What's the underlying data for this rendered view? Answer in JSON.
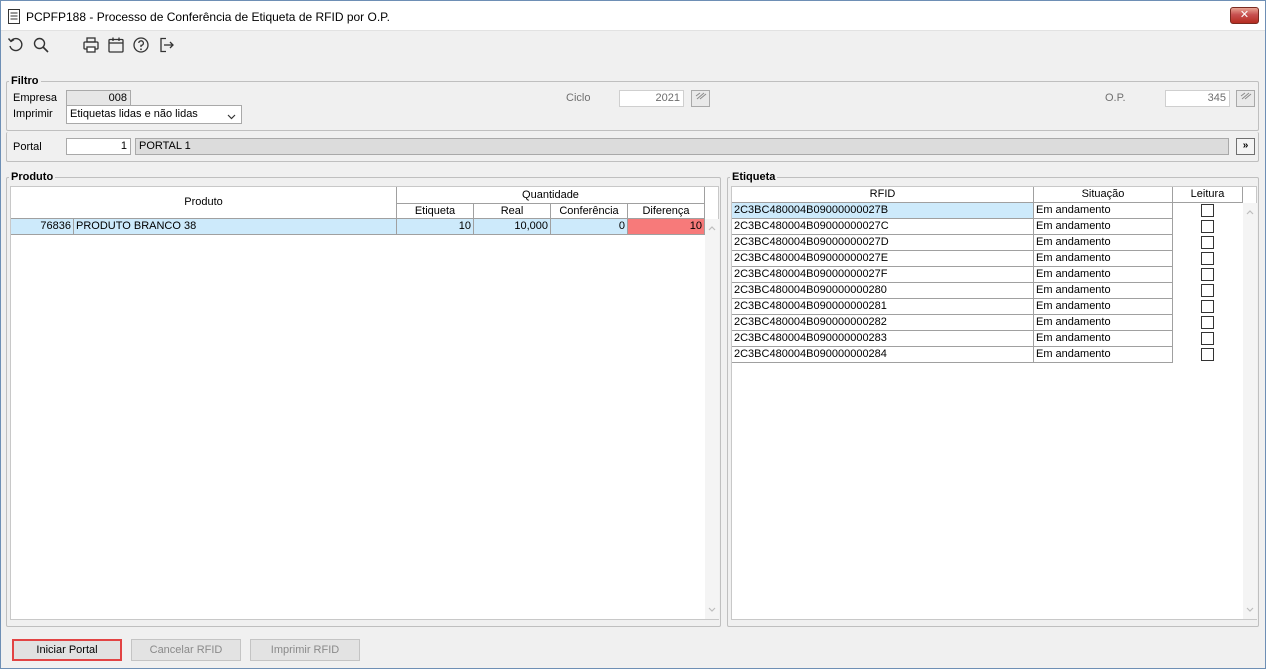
{
  "window": {
    "title": "PCPFP188 - Processo de Conferência de Etiqueta de RFID por O.P.",
    "close_label": "✕"
  },
  "toolbar": {
    "icons": [
      "refresh-icon",
      "search-icon",
      "print-icon",
      "calendar-icon",
      "help-icon",
      "exit-icon"
    ]
  },
  "filtro": {
    "legend": "Filtro",
    "empresa_label": "Empresa",
    "empresa_value": "008",
    "imprimir_label": "Imprimir",
    "imprimir_value": "Etiquetas lidas e não lidas",
    "ciclo_label": "Ciclo",
    "ciclo_value": "2021",
    "op_label": "O.P.",
    "op_value": "345",
    "portal_label": "Portal",
    "portal_value": "1",
    "portal_desc": "PORTAL 1",
    "portal_button": "»"
  },
  "produto": {
    "legend": "Produto",
    "header_produto": "Produto",
    "header_quantidade": "Quantidade",
    "header_etiqueta": "Etiqueta",
    "header_real": "Real",
    "header_conferencia": "Conferência",
    "header_diferenca": "Diferença",
    "rows": [
      {
        "codigo": "76836",
        "descricao": "PRODUTO BRANCO 38",
        "etiqueta": "10",
        "real": "10,000",
        "conferencia": "0",
        "diferenca": "10"
      }
    ]
  },
  "etiqueta": {
    "legend": "Etiqueta",
    "header_rfid": "RFID",
    "header_situacao": "Situação",
    "header_leitura": "Leitura",
    "rows": [
      {
        "rfid": "2C3BC480004B09000000027B",
        "situacao": "Em andamento"
      },
      {
        "rfid": "2C3BC480004B09000000027C",
        "situacao": "Em andamento"
      },
      {
        "rfid": "2C3BC480004B09000000027D",
        "situacao": "Em andamento"
      },
      {
        "rfid": "2C3BC480004B09000000027E",
        "situacao": "Em andamento"
      },
      {
        "rfid": "2C3BC480004B09000000027F",
        "situacao": "Em andamento"
      },
      {
        "rfid": "2C3BC480004B090000000280",
        "situacao": "Em andamento"
      },
      {
        "rfid": "2C3BC480004B090000000281",
        "situacao": "Em andamento"
      },
      {
        "rfid": "2C3BC480004B090000000282",
        "situacao": "Em andamento"
      },
      {
        "rfid": "2C3BC480004B090000000283",
        "situacao": "Em andamento"
      },
      {
        "rfid": "2C3BC480004B090000000284",
        "situacao": "Em andamento"
      }
    ]
  },
  "actions": {
    "iniciar": "Iniciar Portal",
    "cancelar": "Cancelar RFID",
    "imprimir": "Imprimir RFID"
  },
  "colors": {
    "selected_row": "#cdeafb",
    "diferenca_alert": "#f77a7a",
    "primary_border": "#e24444"
  }
}
